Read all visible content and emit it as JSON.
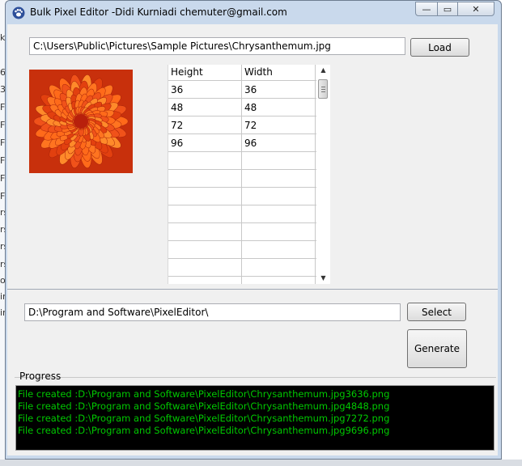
{
  "window": {
    "title": "Bulk Pixel Editor -Didi Kurniadi chemuter@gmail.com",
    "minimize_glyph": "—",
    "maximize_glyph": "▭",
    "close_glyph": "✕"
  },
  "source": {
    "path_value": "C:\\Users\\Public\\Pictures\\Sample Pictures\\Chrysanthemum.jpg",
    "load_label": "Load"
  },
  "sizes_table": {
    "columns": [
      "Height",
      "Width"
    ],
    "rows": [
      [
        "36",
        "36"
      ],
      [
        "48",
        "48"
      ],
      [
        "72",
        "72"
      ],
      [
        "96",
        "96"
      ],
      [
        "",
        ""
      ],
      [
        "",
        ""
      ],
      [
        "",
        ""
      ],
      [
        "",
        ""
      ],
      [
        "",
        ""
      ],
      [
        "",
        ""
      ],
      [
        "",
        ""
      ],
      [
        "",
        ""
      ]
    ]
  },
  "output": {
    "folder_value": "D:\\Program and Software\\PixelEditor\\",
    "select_label": "Select",
    "generate_label": "Generate"
  },
  "progress": {
    "label": "Progress",
    "lines": [
      "File created :D:\\Program and Software\\PixelEditor\\Chrysanthemum.jpg3636.png",
      "File created :D:\\Program and Software\\PixelEditor\\Chrysanthemum.jpg4848.png",
      "File created :D:\\Program and Software\\PixelEditor\\Chrysanthemum.jpg7272.png",
      "File created :D:\\Program and Software\\PixelEditor\\Chrysanthemum.jpg9696.png"
    ],
    "text_color": "#00c800"
  },
  "background_fragments": [
    "ku",
    "6",
    "3",
    "F",
    "F",
    "F",
    "F",
    "F",
    "F",
    "rs",
    "rs",
    "rs",
    "rs",
    "o",
    "in",
    "in"
  ],
  "icons": {
    "app": "paw-print-icon",
    "scroll_up": "chevron-up-icon",
    "scroll_down": "chevron-down-icon"
  }
}
